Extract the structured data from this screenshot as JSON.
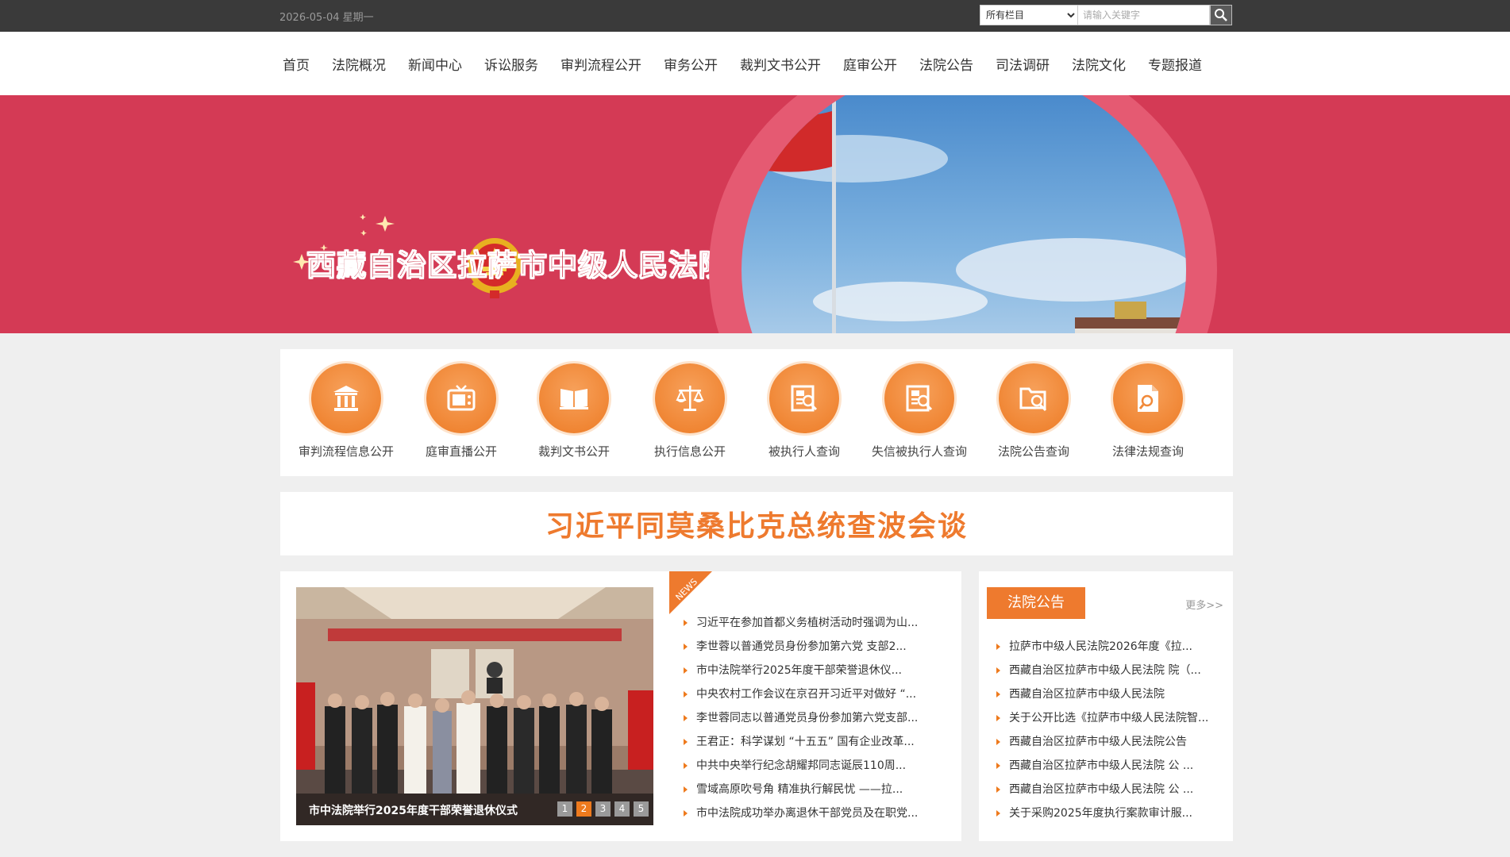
{
  "topbar": {
    "date": "2026-05-04 星期一",
    "search": {
      "scope_selected": "所有栏目",
      "placeholder": "请输入关键字"
    }
  },
  "nav": {
    "items": [
      "首页",
      "法院概况",
      "新闻中心",
      "诉讼服务",
      "审判流程公开",
      "审务公开",
      "裁判文书公开",
      "庭审公开",
      "法院公告",
      "司法调研",
      "法院文化",
      "专题报道"
    ]
  },
  "banner": {
    "court_name": "西藏自治区拉萨市中级人民法院"
  },
  "services": [
    {
      "label": "审判流程信息公开",
      "icon": "courthouse-icon"
    },
    {
      "label": "庭审直播公开",
      "icon": "tv-icon"
    },
    {
      "label": "裁判文书公开",
      "icon": "book-icon"
    },
    {
      "label": "执行信息公开",
      "icon": "scales-icon"
    },
    {
      "label": "被执行人查询",
      "icon": "document-search-icon"
    },
    {
      "label": "失信被执行人查询",
      "icon": "document-search-icon"
    },
    {
      "label": "法院公告查询",
      "icon": "folder-search-icon"
    },
    {
      "label": "法律法规查询",
      "icon": "file-search-icon"
    }
  ],
  "headline": "习近平同莫桑比克总统查波会谈",
  "news": {
    "tag": "NEWS",
    "slide_caption": "市中法院举行2025年度干部荣誉退休仪式",
    "slide_pages": [
      "1",
      "2",
      "3",
      "4",
      "5"
    ],
    "active_page": "2",
    "items": [
      "习近平在参加首都义务植树活动时强调为山...",
      "李世蓉以普通党员身份参加第六党 支部2...",
      "市中法院举行2025年度干部荣誉退休仪...",
      "中央农村工作会议在京召开习近平对做好 “...",
      "李世蓉同志以普通党员身份参加第六党支部...",
      "王君正：科学谋划 “十五五” 国有企业改革...",
      "中共中央举行纪念胡耀邦同志诞辰110周...",
      "雪域高原吹号角 精准执行解民忧 ——拉...",
      "市中法院成功举办离退休干部党员及在职党..."
    ]
  },
  "notice": {
    "title": "法院公告",
    "more": "更多>>",
    "items": [
      "拉萨市中级人民法院2026年度《拉...",
      "西藏自治区拉萨市中级人民法院 院（...",
      "西藏自治区拉萨市中级人民法院",
      "关于公开比选《拉萨市中级人民法院智...",
      "西藏自治区拉萨市中级人民法院公告",
      "西藏自治区拉萨市中级人民法院 公 ...",
      "西藏自治区拉萨市中级人民法院 公 ...",
      "关于采购2025年度执行案款审计服..."
    ]
  },
  "colors": {
    "topbar": "#3a3a3a",
    "banner_red": "#d43a55",
    "accent_orange": "#ee7a2e"
  }
}
